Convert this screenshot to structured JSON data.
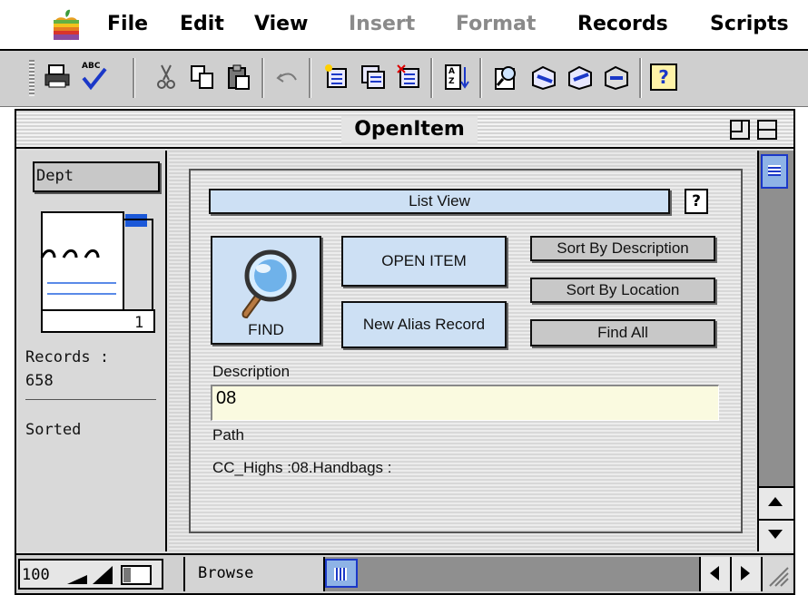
{
  "menubar": {
    "items": [
      {
        "label": "File",
        "enabled": true
      },
      {
        "label": "Edit",
        "enabled": true
      },
      {
        "label": "View",
        "enabled": true
      },
      {
        "label": "Insert",
        "enabled": false
      },
      {
        "label": "Format",
        "enabled": false
      },
      {
        "label": "Records",
        "enabled": true
      },
      {
        "label": "Scripts",
        "enabled": true
      }
    ]
  },
  "toolbar": {
    "icons": [
      "print-icon",
      "spell-check-icon",
      "cut-icon",
      "copy-icon",
      "paste-icon",
      "undo-icon",
      "new-record-icon",
      "duplicate-record-icon",
      "delete-record-icon",
      "sort-icon",
      "find-icon",
      "replace-icon",
      "find-all-icon",
      "omit-icon",
      "help-icon"
    ],
    "spell_glyph": "ABC",
    "sort_glyph": "A Z",
    "help_glyph": "?"
  },
  "window": {
    "title": "OpenItem"
  },
  "sidebar": {
    "layout_name": "Dept",
    "record_number": "1",
    "records_label": "Records :",
    "records_count": "658",
    "sort_status": "Sorted"
  },
  "form": {
    "list_view_button": "List View",
    "help_button": "?",
    "find_button": "FIND",
    "open_item_button": "OPEN ITEM",
    "new_alias_button": "New Alias Record",
    "sort_desc_button": "Sort By Description",
    "sort_loc_button": "Sort By Location",
    "find_all_button": "Find All",
    "description_label": "Description",
    "description_value": "08",
    "path_label": "Path",
    "path_value": "CC_Highs :08.Handbags :"
  },
  "statusbar": {
    "zoom": "100",
    "mode": "Browse"
  },
  "colors": {
    "button_blue": "#cde0f4",
    "field_yellow": "#fafae0",
    "scroll_blue": "#8eb3e6"
  }
}
